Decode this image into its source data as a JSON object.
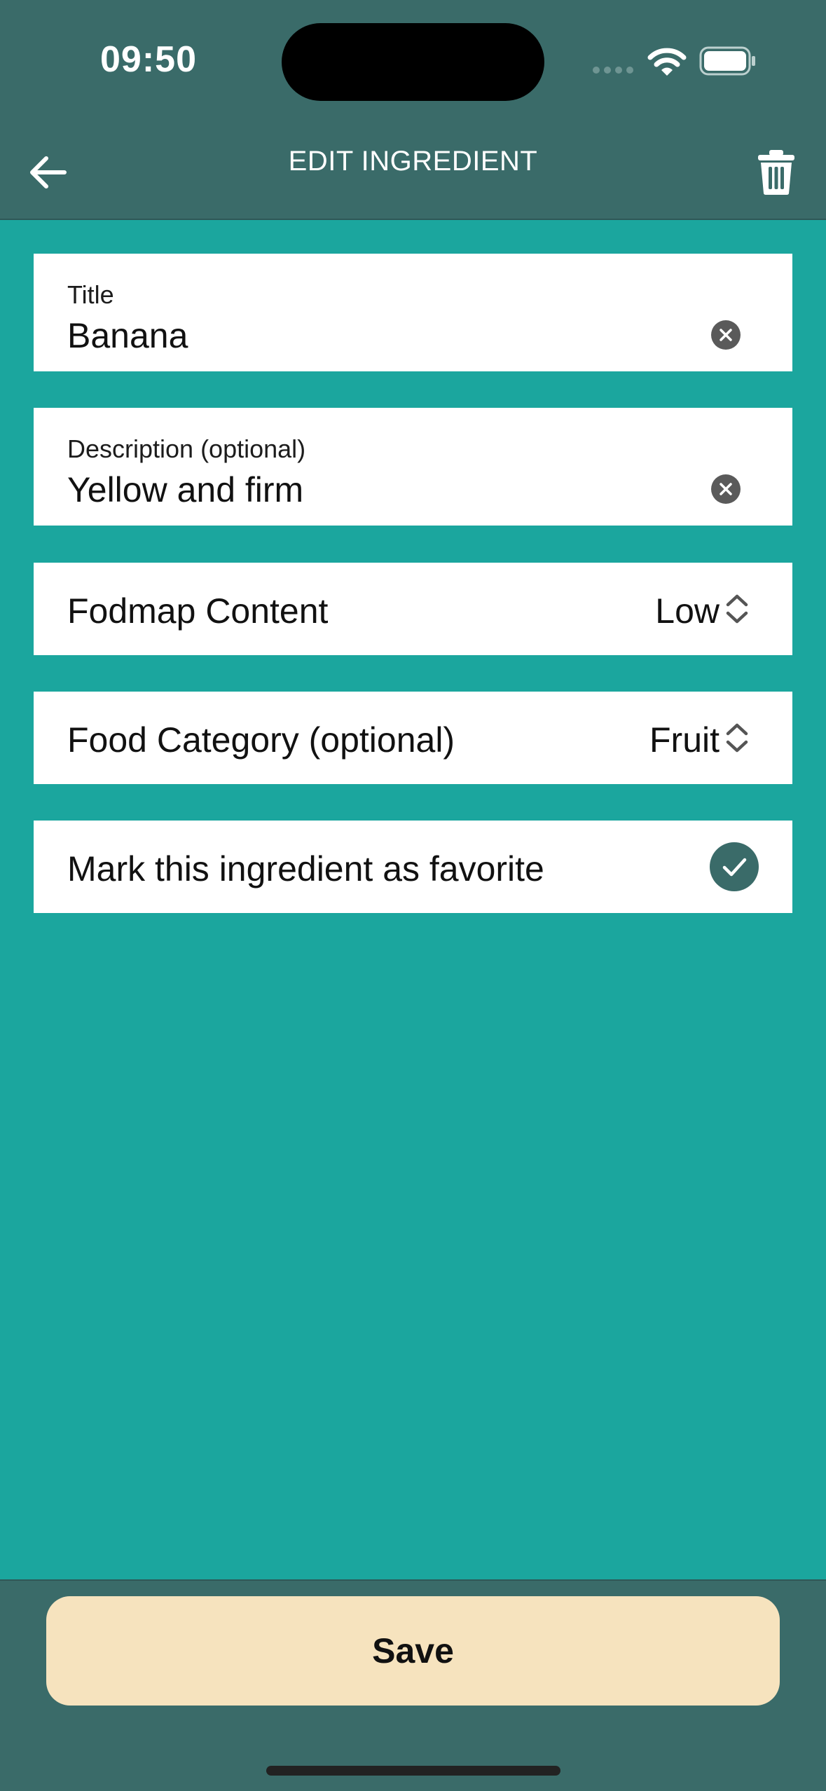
{
  "status_bar": {
    "time": "09:50"
  },
  "header": {
    "title": "EDIT INGREDIENT",
    "back_icon": "arrow-left-icon",
    "delete_icon": "trash-icon"
  },
  "form": {
    "title_field": {
      "label": "Title",
      "value": "Banana"
    },
    "description_field": {
      "label": "Description (optional)",
      "value": "Yellow and firm"
    },
    "fodmap_content": {
      "label": "Fodmap Content",
      "value": "Low"
    },
    "food_category": {
      "label": "Food Category (optional)",
      "value": "Fruit"
    },
    "favorite": {
      "label": "Mark this ingredient as favorite",
      "checked": true
    }
  },
  "footer": {
    "save_label": "Save"
  },
  "colors": {
    "header_bg": "#3a6b69",
    "content_bg": "#1ba69e",
    "save_button_bg": "#f6e3be",
    "check_bg": "#3a6b69"
  }
}
